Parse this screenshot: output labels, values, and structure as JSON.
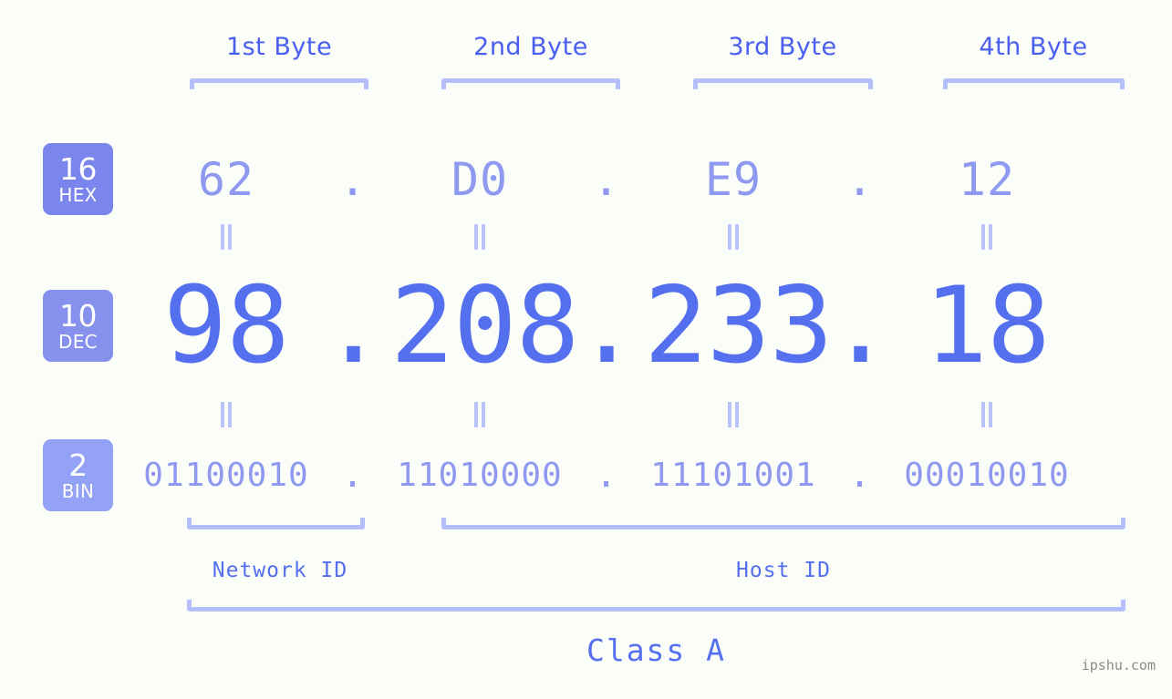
{
  "colors": {
    "background": "#fbfdf8",
    "accent_strong": "#5570ee",
    "accent_mid": "#8e99ef",
    "bracket": "#b5bffc",
    "badge_hex": "#7b86ec",
    "badge_dec": "#8691ee",
    "badge_bin": "#93a2f4",
    "watermark": "#8b8b8b"
  },
  "byte_headers": [
    {
      "label": "1st Byte"
    },
    {
      "label": "2nd Byte"
    },
    {
      "label": "3rd Byte"
    },
    {
      "label": "4th Byte"
    }
  ],
  "bases": [
    {
      "number": "16",
      "system": "HEX"
    },
    {
      "number": "10",
      "system": "DEC"
    },
    {
      "number": "2",
      "system": "BIN"
    }
  ],
  "separator": ".",
  "equality_marker": "=",
  "rows": {
    "hex": {
      "octets": [
        "62",
        "D0",
        "E9",
        "12"
      ]
    },
    "dec": {
      "octets": [
        "98",
        "208",
        "233",
        "18"
      ]
    },
    "bin": {
      "octets": [
        "01100010",
        "11010000",
        "11101001",
        "00010010"
      ]
    }
  },
  "ip_address": {
    "hex": "62.D0.E9.12",
    "dec": "98.208.233.18",
    "bin": "01100010.11010000.11101001.00010010"
  },
  "id_sections": [
    {
      "label": "Network ID"
    },
    {
      "label": "Host ID"
    }
  ],
  "class": {
    "label": "Class A"
  },
  "watermark": {
    "text": "ipshu.com"
  }
}
